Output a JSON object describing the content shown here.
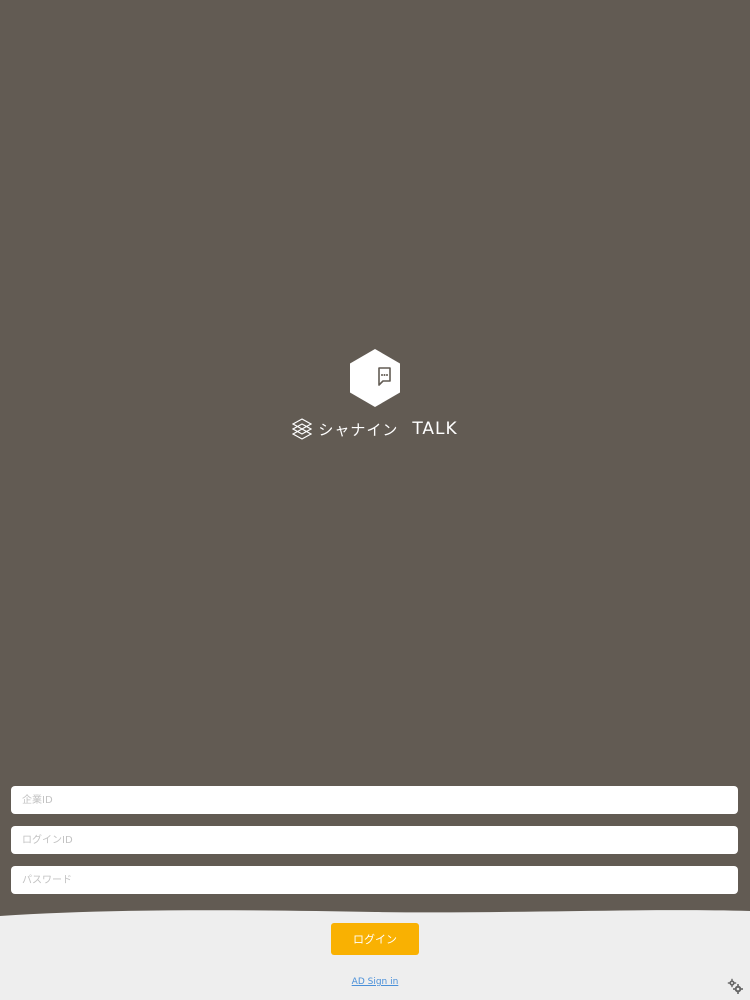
{
  "colors": {
    "background": "#625b53",
    "panel": "#eeeeee",
    "accent": "#f9b102",
    "link": "#4a90d9"
  },
  "logo": {
    "kana": "シャナイン",
    "talk": "TALK",
    "icons": [
      "hexagon-chat-icon",
      "brand-mark-icon"
    ]
  },
  "form": {
    "company_id": {
      "value": "",
      "placeholder": "企業ID"
    },
    "login_id": {
      "value": "",
      "placeholder": "ログインID"
    },
    "password": {
      "value": "",
      "placeholder": "パスワード"
    }
  },
  "actions": {
    "login_label": "ログイン",
    "ad_signin_label": "AD Sign in",
    "settings_icon": "gears-icon"
  }
}
